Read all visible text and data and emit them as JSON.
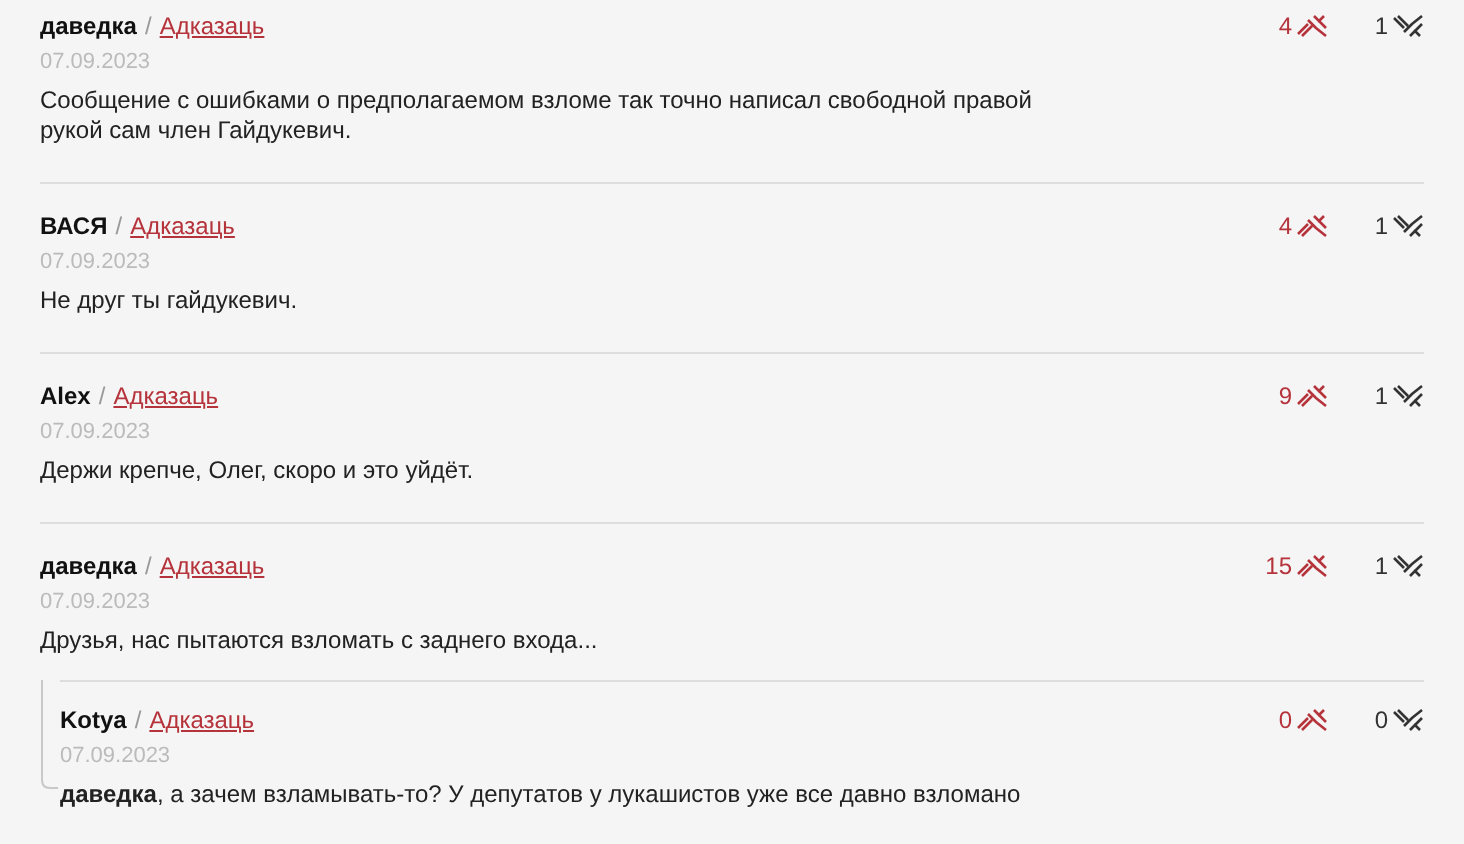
{
  "comments": [
    {
      "author": "даведка",
      "separator": "/",
      "reply_link": "Адказаць",
      "date": "07.09.2023",
      "text": "Сообщение с ошибками о предполагаемом взломе так точно написал свободной правой рукой сам член Гайдукевич.",
      "likes": "4",
      "dislikes": "1"
    },
    {
      "author": "ВАСЯ",
      "separator": "/",
      "reply_link": "Адказаць",
      "date": "07.09.2023",
      "text": "Не друг ты гайдукевич.",
      "likes": "4",
      "dislikes": "1"
    },
    {
      "author": "Alex",
      "separator": "/",
      "reply_link": "Адказаць",
      "date": "07.09.2023",
      "text": "Держи крепче, Олег, скоро и это уйдёт.",
      "likes": "9",
      "dislikes": "1"
    },
    {
      "author": "даведка",
      "separator": "/",
      "reply_link": "Адказаць",
      "date": "07.09.2023",
      "text": "Друзья, нас пытаются взломать с заднего входа...",
      "likes": "15",
      "dislikes": "1",
      "children": [
        {
          "author": "Kotya",
          "separator": "/",
          "reply_link": "Адказаць",
          "date": "07.09.2023",
          "text": "**даведка**, а зачем взламывать-то? У депутатов у лукашистов уже все давно взломано",
          "likes": "0",
          "dislikes": "0"
        }
      ]
    }
  ]
}
